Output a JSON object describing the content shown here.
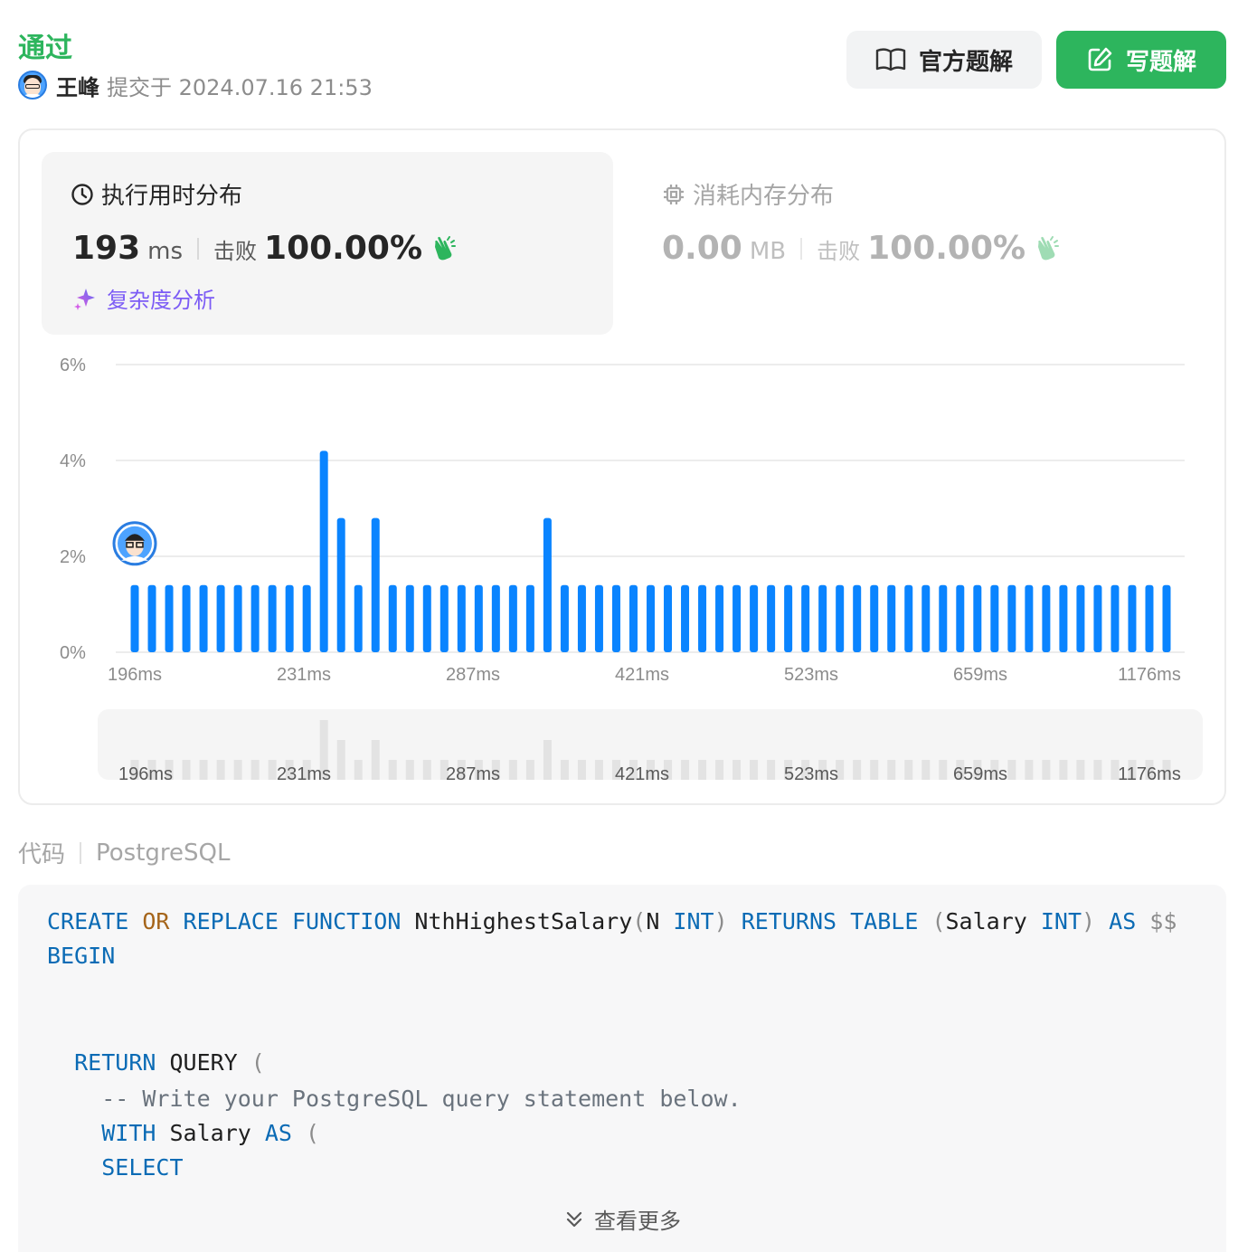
{
  "header": {
    "status": "通过",
    "author": "王峰",
    "submit_text": "提交于 2024.07.16 21:53"
  },
  "actions": {
    "official_label": "官方题解",
    "write_label": "写题解"
  },
  "runtime": {
    "title": "执行用时分布",
    "value": "193",
    "unit": "ms",
    "beat_label": "击败",
    "beat_percent": "100.00%",
    "complexity_label": "复杂度分析"
  },
  "memory": {
    "title": "消耗内存分布",
    "value": "0.00",
    "unit": "MB",
    "beat_label": "击败",
    "beat_percent": "100.00%"
  },
  "chart_data": {
    "type": "bar",
    "y_ticks": [
      "6%",
      "4%",
      "2%",
      "0%"
    ],
    "ylim": [
      0,
      6
    ],
    "x_tick_labels": [
      "196ms",
      "231ms",
      "287ms",
      "421ms",
      "523ms",
      "659ms",
      "1176ms"
    ],
    "values": [
      1.4,
      1.4,
      1.4,
      1.4,
      1.4,
      1.4,
      1.4,
      1.4,
      1.4,
      1.4,
      1.4,
      4.2,
      2.8,
      1.4,
      2.8,
      1.4,
      1.4,
      1.4,
      1.4,
      1.4,
      1.4,
      1.4,
      1.4,
      1.4,
      2.8,
      1.4,
      1.4,
      1.4,
      1.4,
      1.4,
      1.4,
      1.4,
      1.4,
      1.4,
      1.4,
      1.4,
      1.4,
      1.4,
      1.4,
      1.4,
      1.4,
      1.4,
      1.4,
      1.4,
      1.4,
      1.4,
      1.4,
      1.4,
      1.4,
      1.4,
      1.4,
      1.4,
      1.4,
      1.4,
      1.4,
      1.4,
      1.4,
      1.4,
      1.4,
      1.4,
      1.4
    ],
    "user_marker_bar_index": 0,
    "bar_color": "#0a84ff",
    "grid": true
  },
  "code": {
    "label": "代码",
    "language": "PostgreSQL",
    "lines": [
      [
        {
          "t": "CREATE",
          "c": "kw"
        },
        {
          "t": " "
        },
        {
          "t": "OR",
          "c": "kw2"
        },
        {
          "t": " "
        },
        {
          "t": "REPLACE FUNCTION",
          "c": "kw"
        },
        {
          "t": " NthHighestSalary"
        },
        {
          "t": "(",
          "c": "pn"
        },
        {
          "t": "N "
        },
        {
          "t": "INT",
          "c": "kw"
        },
        {
          "t": ")",
          "c": "pn"
        },
        {
          "t": " "
        },
        {
          "t": "RETURNS TABLE",
          "c": "kw"
        },
        {
          "t": " "
        },
        {
          "t": "(",
          "c": "pn"
        },
        {
          "t": "Salary "
        },
        {
          "t": "INT",
          "c": "kw"
        },
        {
          "t": ")",
          "c": "pn"
        },
        {
          "t": " "
        },
        {
          "t": "AS",
          "c": "kw"
        },
        {
          "t": " $$",
          "c": "pn"
        }
      ],
      [
        {
          "t": "BEGIN",
          "c": "kw"
        }
      ],
      [],
      [
        {
          "t": "  "
        },
        {
          "t": "RETURN",
          "c": "kw"
        },
        {
          "t": " QUERY "
        },
        {
          "t": "(",
          "c": "pn"
        }
      ],
      [
        {
          "t": "    "
        },
        {
          "t": "-- Write your PostgreSQL query statement below.",
          "c": "cm"
        }
      ],
      [
        {
          "t": "    "
        },
        {
          "t": "WITH",
          "c": "kw"
        },
        {
          "t": " Salary "
        },
        {
          "t": "AS",
          "c": "kw"
        },
        {
          "t": " "
        },
        {
          "t": "(",
          "c": "pn"
        }
      ],
      [
        {
          "t": "    "
        },
        {
          "t": "SELECT",
          "c": "kw"
        }
      ]
    ],
    "more_label": "查看更多"
  },
  "colors": {
    "accent_green": "#2db55d",
    "bar_blue": "#0a84ff",
    "purple": "#7c5cf5"
  }
}
